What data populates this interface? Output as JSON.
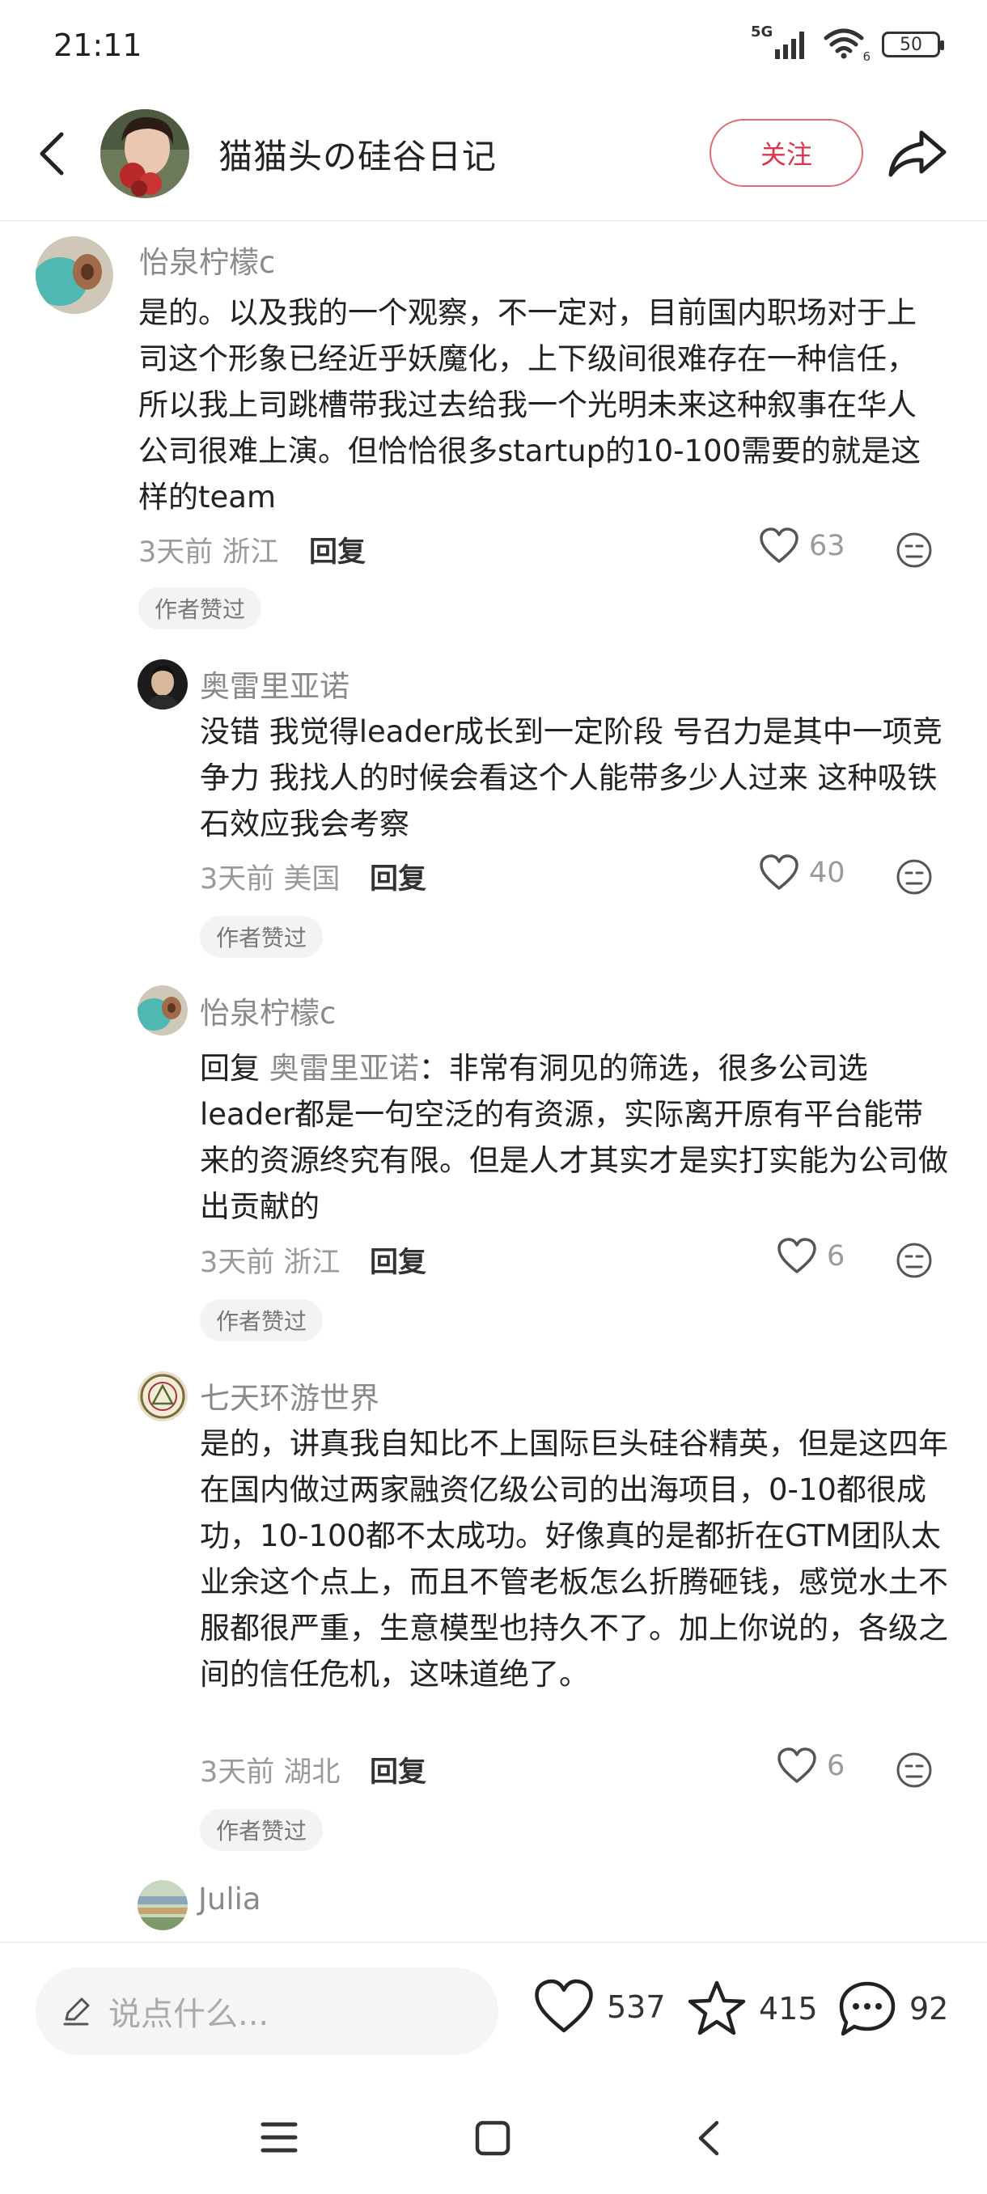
{
  "status_bar": {
    "time": "21:11",
    "network": "5G",
    "wifi_label": "6",
    "battery": "50"
  },
  "header": {
    "title": "猫猫头の硅谷日记",
    "follow_label": "关注"
  },
  "comments": [
    {
      "name": "怡泉柠檬c",
      "text": "是的。以及我的一个观察，不一定对，目前国内职场对于上司这个形象已经近乎妖魔化，上下级间很难存在一种信任，所以我上司跳槽带我过去给我一个光明未来这种叙事在华人公司很难上演。但恰恰很多startup的10-100需要的就是这样的team",
      "time": "3天前",
      "location": "浙江",
      "reply_label": "回复",
      "likes": "63",
      "badge": "作者赞过"
    },
    {
      "name": "奥雷里亚诺",
      "text": "没错 我觉得leader成长到一定阶段 号召力是其中一项竞争力 我找人的时候会看这个人能带多少人过来 这种吸铁石效应我会考察",
      "time": "3天前",
      "location": "美国",
      "reply_label": "回复",
      "likes": "40",
      "badge": "作者赞过"
    },
    {
      "name": "怡泉柠檬c",
      "reply_prefix": "回复",
      "reply_to": "奥雷里亚诺",
      "text": "：非常有洞见的筛选，很多公司选leader都是一句空泛的有资源，实际离开原有平台能带来的资源终究有限。但是人才其实才是实打实能为公司做出贡献的",
      "time": "3天前",
      "location": "浙江",
      "reply_label": "回复",
      "likes": "6",
      "badge": "作者赞过"
    },
    {
      "name": "七天环游世界",
      "text": "是的，讲真我自知比不上国际巨头硅谷精英，但是这四年在国内做过两家融资亿级公司的出海项目，0-10都很成功，10-100都不太成功。好像真的是都折在GTM团队太业余这个点上，而且不管老板怎么折腾砸钱，感觉水土不服都很严重，生意模型也持久不了。加上你说的，各级之间的信任危机，这味道绝了。",
      "time": "3天前",
      "location": "湖北",
      "reply_label": "回复",
      "likes": "6",
      "badge": "作者赞过"
    },
    {
      "name": "Julia"
    }
  ],
  "bottom_bar": {
    "input_placeholder": "说点什么...",
    "likes": "537",
    "favorites": "415",
    "comments": "92"
  },
  "icons": [
    "back-icon",
    "share-icon",
    "heart-icon",
    "dislike-icon",
    "pen-icon",
    "star-icon",
    "chat-icon",
    "menu-icon",
    "home-icon",
    "nav-back-icon"
  ],
  "colors": {
    "accent": "#e0334a",
    "muted_text": "#8a8a8a",
    "badge_bg": "#f3f3f3"
  }
}
